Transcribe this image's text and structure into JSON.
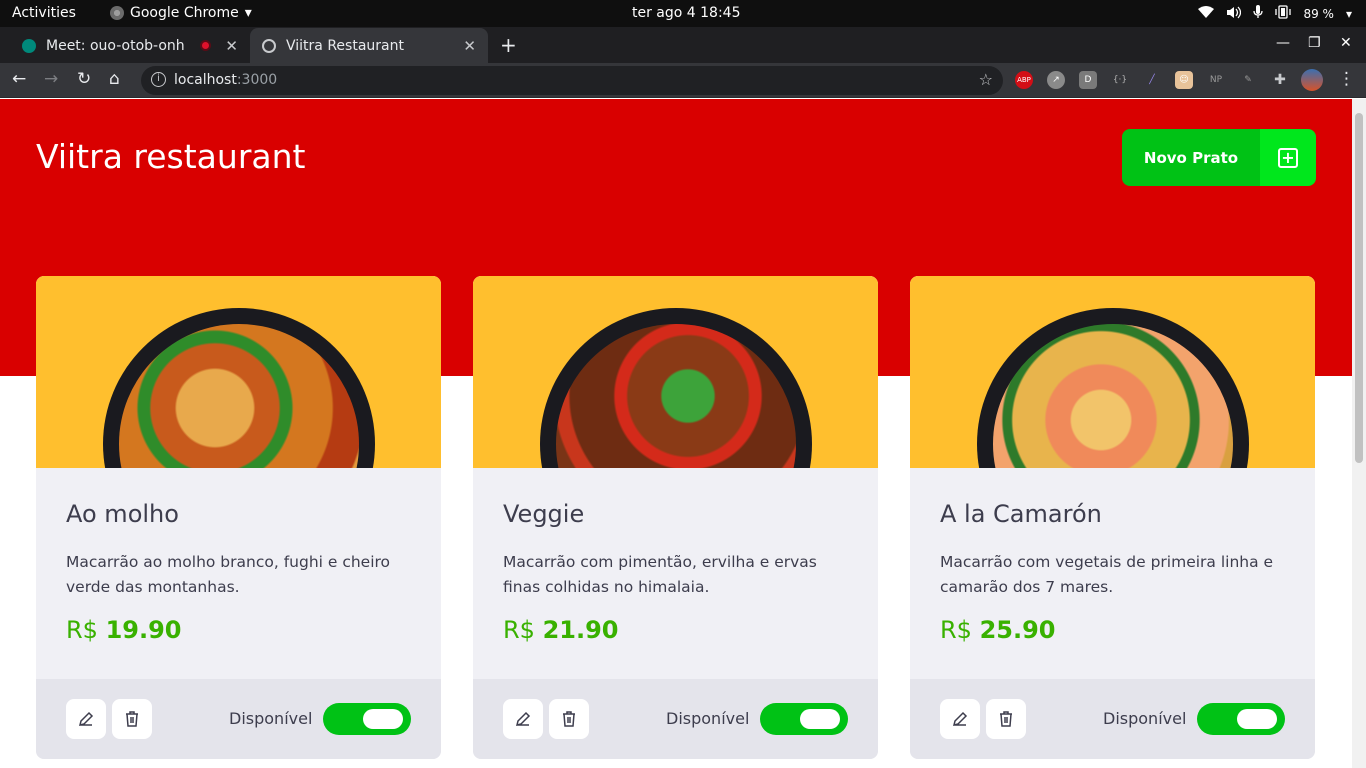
{
  "system": {
    "activities": "Activities",
    "app_name": "Google Chrome",
    "clock": "ter ago 4  18:45",
    "battery": "89 %"
  },
  "tabs": [
    {
      "title": "Meet: ouo-otob-onh",
      "active": false
    },
    {
      "title": "Viitra Restaurant",
      "active": true
    }
  ],
  "address": {
    "host": "localhost",
    "port": ":3000"
  },
  "extensions": [
    "ABP",
    "D",
    "NP"
  ],
  "header": {
    "brand": "Viitra restaurant",
    "new_dish_label": "Novo Prato"
  },
  "colors": {
    "hero_red": "#d90000",
    "accent_green": "#00c215",
    "image_bg": "#ffbf2e",
    "price_green": "#39b100"
  },
  "dishes": [
    {
      "name": "Ao molho",
      "description": "Macarrão ao molho branco, fughi e cheiro verde das montanhas.",
      "currency": "R$",
      "price": "19.90",
      "availability_label": "Disponível",
      "available": true
    },
    {
      "name": "Veggie",
      "description": "Macarrão com pimentão, ervilha e ervas finas colhidas no himalaia.",
      "currency": "R$",
      "price": "21.90",
      "availability_label": "Disponível",
      "available": true
    },
    {
      "name": "A la Camarón",
      "description": "Macarrão com vegetais de primeira linha e camarão dos 7 mares.",
      "currency": "R$",
      "price": "25.90",
      "availability_label": "Disponível",
      "available": true
    }
  ]
}
